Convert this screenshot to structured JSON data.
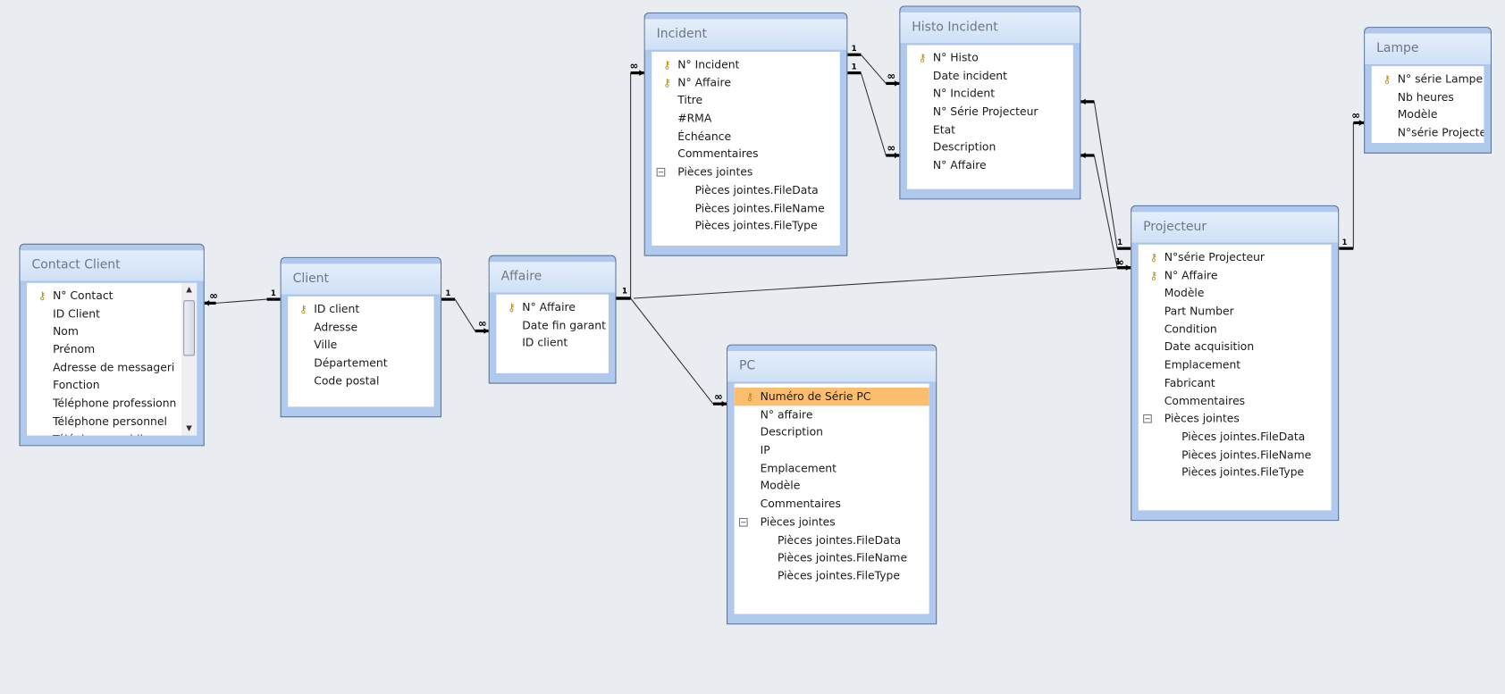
{
  "tables": [
    {
      "id": "contact",
      "title": "Contact Client",
      "scroll": true,
      "fields": [
        {
          "name": "N° Contact",
          "key": true
        },
        {
          "name": "ID Client"
        },
        {
          "name": "Nom"
        },
        {
          "name": "Prénom"
        },
        {
          "name": "Adresse de messageri"
        },
        {
          "name": "Fonction"
        },
        {
          "name": "Téléphone professionn"
        },
        {
          "name": "Téléphone personnel"
        },
        {
          "name": "Téléphone mobile"
        }
      ]
    },
    {
      "id": "client",
      "title": "Client",
      "fields": [
        {
          "name": "ID client",
          "key": true
        },
        {
          "name": "Adresse"
        },
        {
          "name": "Ville"
        },
        {
          "name": "Département"
        },
        {
          "name": "Code postal"
        }
      ]
    },
    {
      "id": "affaire",
      "title": "Affaire",
      "fields": [
        {
          "name": "N° Affaire",
          "key": true
        },
        {
          "name": "Date fin garant"
        },
        {
          "name": "ID client"
        }
      ]
    },
    {
      "id": "incident",
      "title": "Incident",
      "fields": [
        {
          "name": "N° Incident",
          "key": true
        },
        {
          "name": "N° Affaire",
          "key": true
        },
        {
          "name": "Titre"
        },
        {
          "name": "#RMA"
        },
        {
          "name": "Échéance"
        },
        {
          "name": "Commentaires"
        },
        {
          "name": "Pièces jointes",
          "group": true
        },
        {
          "name": "Pièces jointes.FileData",
          "child": true
        },
        {
          "name": "Pièces jointes.FileName",
          "child": true
        },
        {
          "name": "Pièces jointes.FileType",
          "child": true
        }
      ]
    },
    {
      "id": "histo",
      "title": "Histo Incident",
      "fields": [
        {
          "name": "N° Histo",
          "key": true
        },
        {
          "name": "Date incident"
        },
        {
          "name": "N° Incident"
        },
        {
          "name": "N° Série Projecteur"
        },
        {
          "name": "Etat"
        },
        {
          "name": "Description"
        },
        {
          "name": "N° Affaire"
        }
      ]
    },
    {
      "id": "lampe",
      "title": "Lampe",
      "fields": [
        {
          "name": "N° série Lampe",
          "key": true
        },
        {
          "name": "Nb heures"
        },
        {
          "name": "Modèle"
        },
        {
          "name": "N°série Projecteur"
        }
      ]
    },
    {
      "id": "projecteur",
      "title": "Projecteur",
      "fields": [
        {
          "name": "N°série Projecteur",
          "key": true
        },
        {
          "name": "N° Affaire",
          "key": true
        },
        {
          "name": "Modèle"
        },
        {
          "name": "Part Number"
        },
        {
          "name": "Condition"
        },
        {
          "name": "Date acquisition"
        },
        {
          "name": "Emplacement"
        },
        {
          "name": "Fabricant"
        },
        {
          "name": "Commentaires"
        },
        {
          "name": "Pièces jointes",
          "group": true
        },
        {
          "name": "Pièces jointes.FileData",
          "child": true
        },
        {
          "name": "Pièces jointes.FileName",
          "child": true
        },
        {
          "name": "Pièces jointes.FileType",
          "child": true
        }
      ]
    },
    {
      "id": "pc",
      "title": "PC",
      "fields": [
        {
          "name": "Numéro de Série PC",
          "key": true,
          "selected": true
        },
        {
          "name": "N° affaire"
        },
        {
          "name": "Description"
        },
        {
          "name": "IP"
        },
        {
          "name": "Emplacement"
        },
        {
          "name": "Modèle"
        },
        {
          "name": "Commentaires"
        },
        {
          "name": "Pièces jointes",
          "group": true
        },
        {
          "name": "Pièces jointes.FileData",
          "child": true
        },
        {
          "name": "Pièces jointes.FileName",
          "child": true
        },
        {
          "name": "Pièces jointes.FileType",
          "child": true
        }
      ]
    }
  ],
  "relationships": [
    {
      "from": "Client",
      "to": "Contact Client",
      "one": "1",
      "many": "∞"
    },
    {
      "from": "Client",
      "to": "Affaire",
      "one": "1",
      "many": "∞"
    },
    {
      "from": "Affaire",
      "to": "Incident",
      "one": "1",
      "many": "∞"
    },
    {
      "from": "Affaire",
      "to": "PC",
      "one": "1",
      "many": "∞"
    },
    {
      "from": "Affaire",
      "to": "Projecteur",
      "one": "1",
      "many": "∞"
    },
    {
      "from": "Incident",
      "to": "Histo Incident",
      "one": "1",
      "many": "∞"
    },
    {
      "from": "Incident",
      "to": "Histo Incident",
      "one": "1",
      "many": "∞"
    },
    {
      "from": "Projecteur",
      "to": "Histo Incident",
      "one": "1",
      "many": "∞"
    },
    {
      "from": "Projecteur",
      "to": "Histo Incident",
      "one": "1",
      "many": "∞"
    },
    {
      "from": "Projecteur",
      "to": "Lampe",
      "one": "1",
      "many": "∞"
    }
  ],
  "colors": {
    "background": "#e9edf1",
    "selected_field": "#fbbe6f",
    "table_frame": "#b0c9ec"
  }
}
